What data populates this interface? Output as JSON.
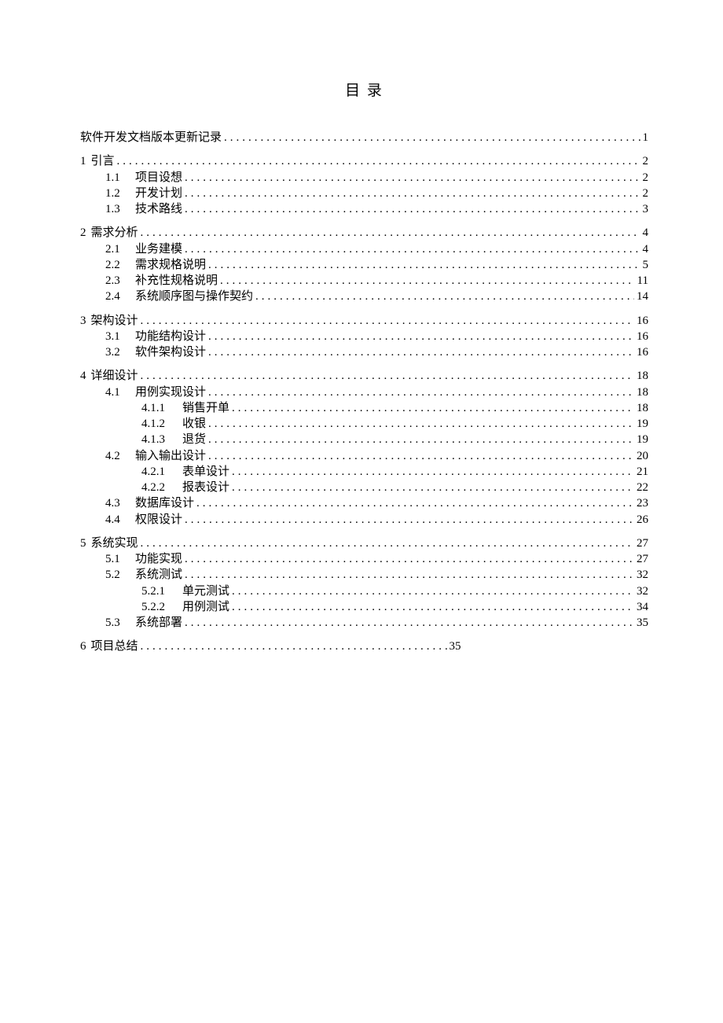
{
  "title": "目 录",
  "entries": [
    {
      "group": 0,
      "indent": 0,
      "num": "",
      "label": "软件开发文档版本更新记录",
      "page": "1"
    },
    {
      "group": 1,
      "indent": 0,
      "num": "1",
      "label": "引言",
      "page": "2"
    },
    {
      "group": 1,
      "indent": 1,
      "num": "1.1",
      "label": "项目设想",
      "page": "2"
    },
    {
      "group": 1,
      "indent": 1,
      "num": "1.2",
      "label": "开发计划",
      "page": "2"
    },
    {
      "group": 1,
      "indent": 1,
      "num": "1.3",
      "label": "技术路线",
      "page": "3"
    },
    {
      "group": 2,
      "indent": 0,
      "num": "2",
      "label": "需求分析",
      "page": "4"
    },
    {
      "group": 2,
      "indent": 1,
      "num": "2.1",
      "label": "业务建模",
      "page": "4"
    },
    {
      "group": 2,
      "indent": 1,
      "num": "2.2",
      "label": "需求规格说明",
      "page": "5"
    },
    {
      "group": 2,
      "indent": 1,
      "num": "2.3",
      "label": "补充性规格说明",
      "page": "11"
    },
    {
      "group": 2,
      "indent": 1,
      "num": "2.4",
      "label": "系统顺序图与操作契约",
      "page": "14"
    },
    {
      "group": 3,
      "indent": 0,
      "num": "3",
      "label": "架构设计",
      "page": "16"
    },
    {
      "group": 3,
      "indent": 1,
      "num": "3.1",
      "label": "功能结构设计",
      "page": "16"
    },
    {
      "group": 3,
      "indent": 1,
      "num": "3.2",
      "label": "软件架构设计",
      "page": "16"
    },
    {
      "group": 4,
      "indent": 0,
      "num": "4",
      "label": "详细设计",
      "page": "18"
    },
    {
      "group": 4,
      "indent": 1,
      "num": "4.1",
      "label": "用例实现设计",
      "page": "18"
    },
    {
      "group": 4,
      "indent": 2,
      "num": "4.1.1",
      "label": "销售开单",
      "page": "18"
    },
    {
      "group": 4,
      "indent": 2,
      "num": "4.1.2",
      "label": "收银",
      "page": "19"
    },
    {
      "group": 4,
      "indent": 2,
      "num": "4.1.3",
      "label": "退货",
      "page": "19"
    },
    {
      "group": 4,
      "indent": 1,
      "num": "4.2",
      "label": "输入输出设计",
      "page": "20"
    },
    {
      "group": 4,
      "indent": 2,
      "num": "4.2.1",
      "label": "表单设计",
      "page": "21"
    },
    {
      "group": 4,
      "indent": 2,
      "num": "4.2.2",
      "label": "报表设计",
      "page": "22"
    },
    {
      "group": 4,
      "indent": 1,
      "num": "4.3",
      "label": "数据库设计",
      "page": "23"
    },
    {
      "group": 4,
      "indent": 1,
      "num": "4.4",
      "label": "权限设计",
      "page": "26"
    },
    {
      "group": 5,
      "indent": 0,
      "num": "5",
      "label": "系统实现",
      "page": "27"
    },
    {
      "group": 5,
      "indent": 1,
      "num": "5.1",
      "label": "功能实现",
      "page": "27"
    },
    {
      "group": 5,
      "indent": 1,
      "num": "5.2",
      "label": "系统测试",
      "page": "32"
    },
    {
      "group": 5,
      "indent": 2,
      "num": "5.2.1",
      "label": "单元测试",
      "page": "32"
    },
    {
      "group": 5,
      "indent": 2,
      "num": "5.2.2",
      "label": "用例测试",
      "page": "34"
    },
    {
      "group": 5,
      "indent": 1,
      "num": "5.3",
      "label": "系统部署",
      "page": "35"
    },
    {
      "group": 6,
      "indent": 0,
      "num": "6",
      "label": "项目总结",
      "page": "35",
      "short": true
    }
  ]
}
